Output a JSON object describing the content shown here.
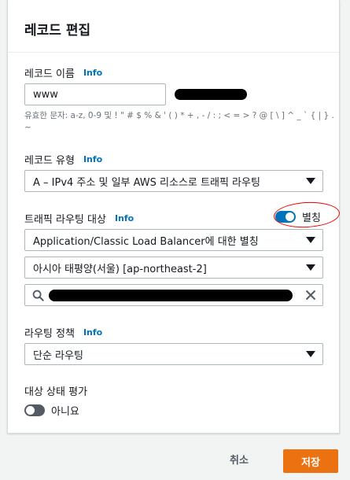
{
  "panel": {
    "title": "레코드 편집"
  },
  "record_name": {
    "label": "레코드 이름",
    "info": "Info",
    "value": "www",
    "hint": "유효한 문자: a-z, 0-9 및 ! \" # $ % & ' ( ) * + , - / : ; < = > ? @ [ \\ ] ^ _ ` { | } . ~"
  },
  "record_type": {
    "label": "레코드 유형",
    "info": "Info",
    "selected": "A – IPv4 주소 및 일부 AWS 리소스로 트래픽 라우팅"
  },
  "route_target": {
    "label": "트래픽 라우팅 대상",
    "info": "Info",
    "alias_toggle": {
      "label": "별칭",
      "on": true
    },
    "endpoint_type": "Application/Classic Load Balancer에 대한 별칭",
    "region": "아시아 태평양(서울) [ap-northeast-2]",
    "search_value": ""
  },
  "routing_policy": {
    "label": "라우팅 정책",
    "info": "Info",
    "selected": "단순 라우팅"
  },
  "health_eval": {
    "label": "대상 상태 평가",
    "toggle": {
      "label": "아니요",
      "on": false
    }
  },
  "footer": {
    "cancel": "취소",
    "save": "저장"
  },
  "colors": {
    "accent": "#0073bb",
    "primary_button": "#ec7211",
    "annotation": "#e00000"
  }
}
